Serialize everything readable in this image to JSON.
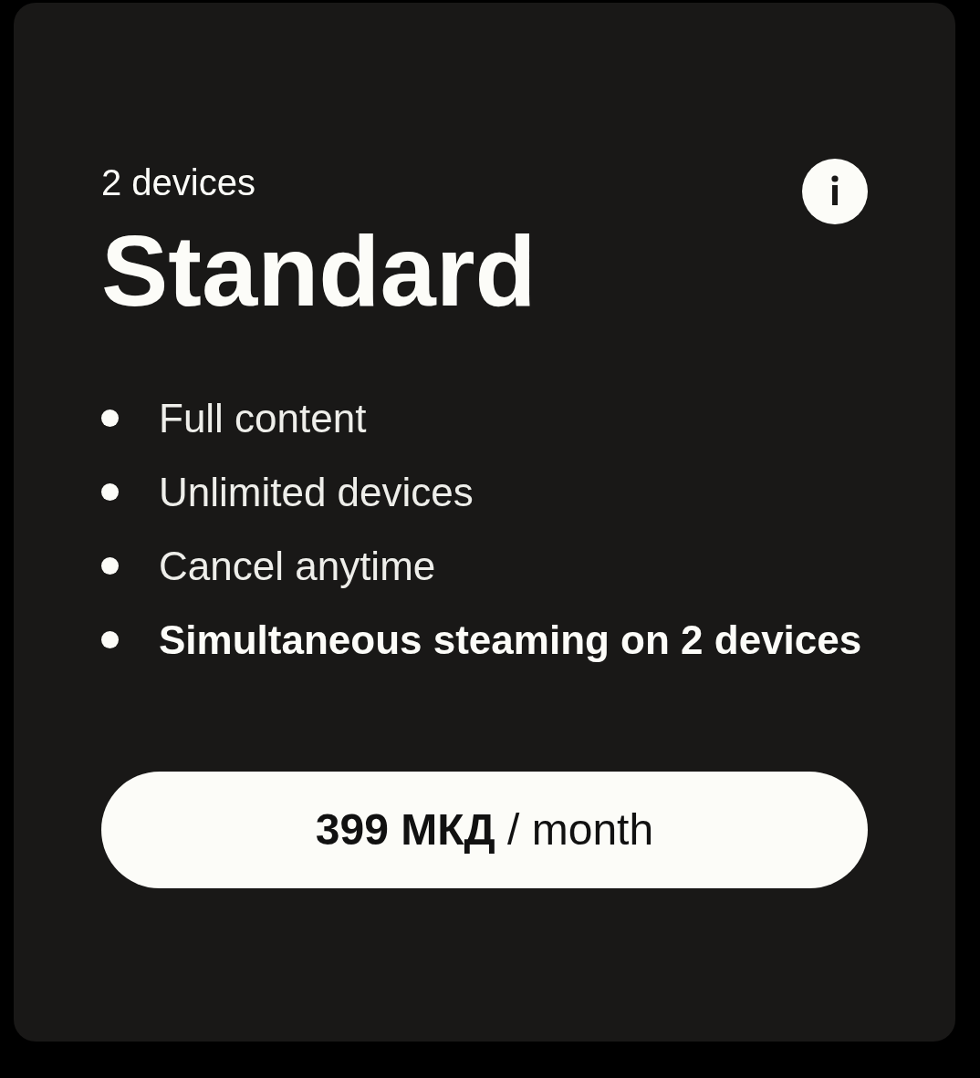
{
  "plan": {
    "devices": "2 devices",
    "name": "Standard"
  },
  "features": [
    {
      "text": "Full content",
      "highlighted": false
    },
    {
      "text": "Unlimited devices",
      "highlighted": false
    },
    {
      "text": "Cancel anytime",
      "highlighted": false
    },
    {
      "text": "Simultaneous steaming on 2 devices",
      "highlighted": true
    }
  ],
  "price_button": {
    "label": "**399 МКД** / month"
  }
}
